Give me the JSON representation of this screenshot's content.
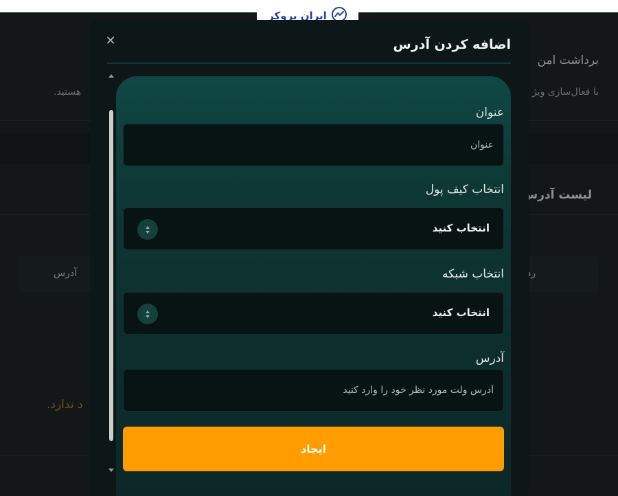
{
  "brand": {
    "logo_text": "ایران بروکر"
  },
  "background_page": {
    "section_title": "برداشت امن",
    "description_start": "با فعال‌سازی ویژ",
    "description_end": "هستید.",
    "list_title": "لیست آدرس",
    "table_col_right": "رد",
    "table_col_address": "آدرس",
    "empty_message": "د ندارد."
  },
  "modal": {
    "title": "اضافه کردن آدرس",
    "close_symbol": "✕",
    "fields": {
      "title": {
        "label": "عنوان",
        "placeholder": "عنوان",
        "value": ""
      },
      "wallet": {
        "label": "انتخاب کیف پول",
        "selected": "انتخاب کنید"
      },
      "network": {
        "label": "انتخاب شبکه",
        "selected": "انتخاب کنید"
      },
      "address": {
        "label": "آدرس",
        "placeholder": "آدرس ولت مورد نظر خود را وارد کنید",
        "value": ""
      }
    },
    "submit_label": "ایجاد"
  },
  "colors": {
    "accent": "#ff9d00",
    "card": "#0d3634",
    "brand_blue": "#1b3fa8",
    "muted_gold": "#9c7a35"
  }
}
